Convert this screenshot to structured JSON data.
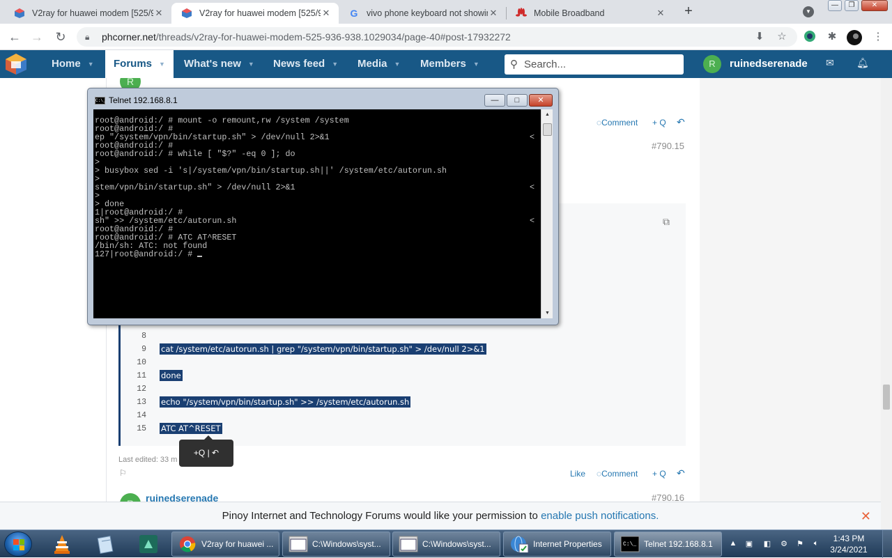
{
  "browser": {
    "tabs": [
      {
        "title": "V2ray for huawei modem [525/93",
        "active": false
      },
      {
        "title": "V2ray for huawei modem [525/93",
        "active": true
      },
      {
        "title": "vivo phone keyboard not showin",
        "active": false
      },
      {
        "title": "Mobile Broadband",
        "active": false
      }
    ],
    "url_host": "phcorner.net",
    "url_path": "/threads/v2ray-for-huawei-modem-525-936-938.1029034/page-40#post-17932272"
  },
  "forum": {
    "nav": [
      "Home",
      "Forums",
      "What's new",
      "News feed",
      "Media",
      "Members"
    ],
    "active_nav": "Forums",
    "search_placeholder": "Search...",
    "user_initial": "R",
    "username": "ruinedserenade"
  },
  "post": {
    "actions": {
      "comment": "Comment",
      "quote": "+ Q",
      "like": "Like"
    },
    "post_number_1": "#790.15",
    "post_number_2": "#790.16",
    "author_next": "ruinedserenade",
    "author_initial": "R",
    "last_edited": "Last edited: 33 m",
    "quote_popup": "+Q  |  ↶",
    "code_lines": [
      {
        "n": "8",
        "text": ""
      },
      {
        "n": "9",
        "text": "cat /system/etc/autorun.sh | grep \"/system/vpn/bin/startup.sh\" > /dev/null 2>&1"
      },
      {
        "n": "10",
        "text": ""
      },
      {
        "n": "11",
        "text": "done"
      },
      {
        "n": "12",
        "text": ""
      },
      {
        "n": "13",
        "text": "echo \"/system/vpn/bin/startup.sh\" >> /system/etc/autorun.sh"
      },
      {
        "n": "14",
        "text": ""
      },
      {
        "n": "15",
        "text": "ATC AT^RESET"
      }
    ]
  },
  "push_banner": {
    "text": "Pinoy Internet and Technology Forums would like your permission to",
    "link": "enable push notifications."
  },
  "telnet": {
    "title": "Telnet 192.168.8.1",
    "lines": [
      {
        "text": "root@android:/ # mount -o remount,rw /system /system",
        "wrap": false
      },
      {
        "text": "root@android:/ #",
        "wrap": false
      },
      {
        "text": "ep \"/system/vpn/bin/startup.sh\" > /dev/null 2>&1",
        "wrap": true
      },
      {
        "text": "root@android:/ #",
        "wrap": false
      },
      {
        "text": "root@android:/ # while [ \"$?\" -eq 0 ]; do",
        "wrap": false
      },
      {
        "text": ">",
        "wrap": false
      },
      {
        "text": "> busybox sed -i 's|/system/vpn/bin/startup.sh||' /system/etc/autorun.sh",
        "wrap": false
      },
      {
        "text": ">",
        "wrap": false
      },
      {
        "text": "stem/vpn/bin/startup.sh\" > /dev/null 2>&1",
        "wrap": true
      },
      {
        "text": ">",
        "wrap": false
      },
      {
        "text": "> done",
        "wrap": false
      },
      {
        "text": "1|root@android:/ #",
        "wrap": false
      },
      {
        "text": "sh\" >> /system/etc/autorun.sh",
        "wrap": true
      },
      {
        "text": "root@android:/ #",
        "wrap": false
      },
      {
        "text": "root@android:/ # ATC AT^RESET",
        "wrap": false
      },
      {
        "text": "/bin/sh: ATC: not found",
        "wrap": false
      },
      {
        "text": "127|root@android:/ # ",
        "wrap": false,
        "cursor": true
      }
    ],
    "wrap_marker": "<"
  },
  "taskbar": {
    "items": [
      {
        "label": "V2ray for huawei ...",
        "icon": "chrome-icon"
      },
      {
        "label": "C:\\Windows\\syst...",
        "icon": "cmd-window-icon"
      },
      {
        "label": "C:\\Windows\\syst...",
        "icon": "cmd-window-icon"
      },
      {
        "label": "Internet Properties",
        "icon": "internet-properties-icon"
      },
      {
        "label": "Telnet 192.168.8.1",
        "icon": "telnet-icon",
        "active": true
      }
    ],
    "time": "1:43 PM",
    "date": "3/24/2021"
  }
}
